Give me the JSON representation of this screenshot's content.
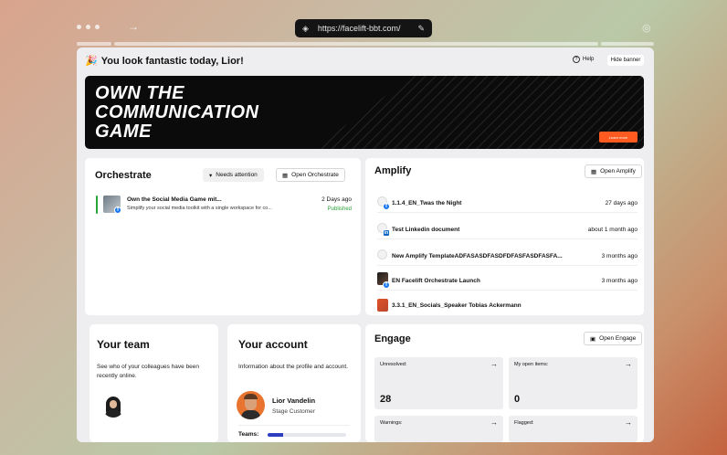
{
  "browser": {
    "url": "https://facelift-bbt.com/"
  },
  "header": {
    "greeting": "You look fantastic today, Lior!",
    "help_label": "Help",
    "hide_banner_label": "Hide banner"
  },
  "banner": {
    "headline": "OWN THE COMMUNICATION GAME",
    "cta_label": "Learn more"
  },
  "orchestrate": {
    "title": "Orchestrate",
    "filter_label": "Needs attention",
    "open_label": "Open Orchestrate",
    "items": [
      {
        "title": "Own the Social Media Game mit...",
        "subtitle": "Simplify your social media toolkit with a single workspace for co...",
        "date": "2 Days ago",
        "status": "Published"
      }
    ]
  },
  "amplify": {
    "title": "Amplify",
    "open_label": "Open Amplify",
    "items": [
      {
        "name": "1.1.4_EN_Twas the Night",
        "when": "27 days ago"
      },
      {
        "name": "Test Linkedin document",
        "when": "about 1 month ago"
      },
      {
        "name": "New Amplify TemplateADFASASDFASDFDFASFASDFASFA...",
        "when": "3 months ago"
      },
      {
        "name": "EN Facelift Orchestrate Launch",
        "when": "3 months ago"
      },
      {
        "name": "3.3.1_EN_Socials_Speaker Tobias Ackermann",
        "when": ""
      }
    ]
  },
  "team": {
    "title": "Your team",
    "description": "See who of your colleagues have been recently online."
  },
  "account": {
    "title": "Your account",
    "description": "Information about the profile and account.",
    "name": "Lior Vandelin",
    "role": "Stage Customer",
    "teams_label": "Teams:",
    "teams_progress": 0.2
  },
  "engage": {
    "title": "Engage",
    "open_label": "Open Engage",
    "tiles": [
      {
        "label": "Unresolved:",
        "value": "28"
      },
      {
        "label": "My open items:",
        "value": "0"
      },
      {
        "label": "Warnings:",
        "value": ""
      },
      {
        "label": "Flagged:",
        "value": ""
      }
    ]
  },
  "colors": {
    "accent_orange": "#ff5a1f",
    "published_green": "#2aa33a",
    "progress_blue": "#2d3fbf"
  }
}
